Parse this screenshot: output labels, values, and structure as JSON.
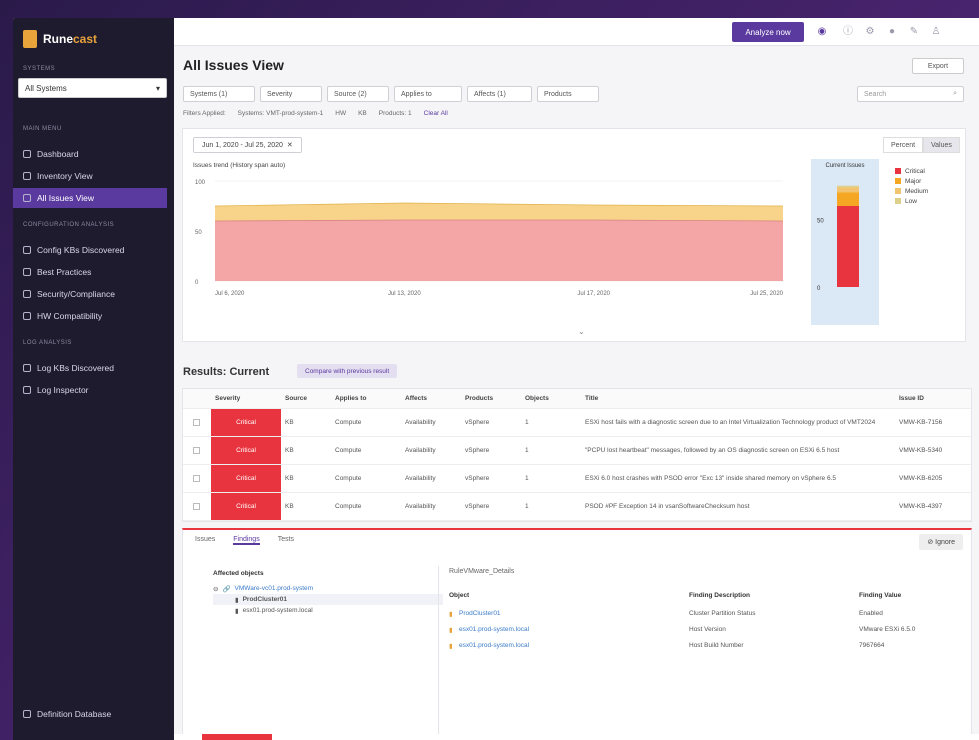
{
  "brand": {
    "name_a": "Rune",
    "name_b": "cast"
  },
  "sidebar": {
    "system_caption": "SYSTEMS",
    "system_select": "All Systems",
    "section1": "MAIN MENU",
    "items1": [
      {
        "label": "Dashboard",
        "icon": "dashboard-icon"
      },
      {
        "label": "Inventory View",
        "icon": "grid-icon"
      },
      {
        "label": "All Issues View",
        "icon": "issues-icon",
        "active": true
      }
    ],
    "section2": "CONFIGURATION ANALYSIS",
    "items2": [
      {
        "label": "Config KBs Discovered",
        "icon": "kb-icon"
      },
      {
        "label": "Best Practices",
        "icon": "check-icon"
      },
      {
        "label": "Security/Compliance",
        "icon": "shield-icon"
      },
      {
        "label": "HW Compatibility",
        "icon": "hardware-icon"
      }
    ],
    "section3": "LOG ANALYSIS",
    "items3": [
      {
        "label": "Log KBs Discovered",
        "icon": "log-icon"
      },
      {
        "label": "Log Inspector",
        "icon": "pulse-icon"
      }
    ],
    "bottom_item": "Definition Database"
  },
  "topbar": {
    "analyze_label": "Analyze now"
  },
  "page": {
    "title": "All Issues View",
    "export_label": "Export",
    "filters": [
      "Systems (1)",
      "Severity",
      "Source (2)",
      "Applies to",
      "Affects (1)",
      "Products"
    ],
    "search_placeholder": "Search",
    "applied": [
      "Filters Applied:",
      "Systems: VMT-prod-system-1",
      "HW",
      "KB",
      "Products: 1",
      "Clear All"
    ],
    "date_range": "Jun 1, 2020 - Jul 25, 2020",
    "toggle_a": "Percent",
    "toggle_b": "Values",
    "chart_label": "Issues trend (History span auto)",
    "bar_title": "Current Issues",
    "results_title": "Results: Current",
    "compare_label": "Compare with previous result"
  },
  "chart_data": [
    {
      "type": "area",
      "title": "Issues trend (History span auto)",
      "x": [
        "Jul 6, 2020",
        "Jul 13, 2020",
        "Jul 17, 2020",
        "Jul 25, 2020"
      ],
      "series": [
        {
          "name": "Critical",
          "values": [
            60,
            61,
            61,
            60
          ],
          "color": "#f4a6a6"
        },
        {
          "name": "Major",
          "values": [
            75,
            78,
            76,
            75
          ],
          "color": "#f7d48a"
        }
      ],
      "ylim": [
        0,
        100
      ],
      "yticks": [
        "100",
        "50",
        "0"
      ]
    },
    {
      "type": "bar",
      "title": "Current Issues",
      "categories": [
        "Current"
      ],
      "series": [
        {
          "name": "Critical",
          "values": [
            60
          ]
        },
        {
          "name": "Major",
          "values": [
            10
          ]
        },
        {
          "name": "Medium",
          "values": [
            4
          ]
        },
        {
          "name": "Low",
          "values": [
            1
          ]
        }
      ],
      "yticks": [
        "50",
        "0"
      ],
      "legend": [
        "Critical",
        "Major",
        "Medium",
        "Low"
      ],
      "colors": [
        "#e8343f",
        "#f5a623",
        "#f2c46f",
        "#dcd08a"
      ]
    }
  ],
  "table": {
    "headers": [
      "Severity",
      "Source",
      "Applies to",
      "Affects",
      "Products",
      "Objects",
      "Title",
      "Issue ID"
    ],
    "rows": [
      {
        "severity": "Critical",
        "source": "KB",
        "applies": "Compute",
        "affects": "Availability",
        "products": "vSphere",
        "objects": "1",
        "title": "ESXi host fails with a diagnostic screen due to an Intel Virtualization Technology product of VMT2024",
        "id": "VMW-KB-7156"
      },
      {
        "severity": "Critical",
        "source": "KB",
        "applies": "Compute",
        "affects": "Availability",
        "products": "vSphere",
        "objects": "1",
        "title": "\"PCPU lost heartbeat\" messages, followed by an OS diagnostic screen on ESXi 6.5 host",
        "id": "VMW-KB-5340"
      },
      {
        "severity": "Critical",
        "source": "KB",
        "applies": "Compute",
        "affects": "Availability",
        "products": "vSphere",
        "objects": "1",
        "title": "ESXi 6.0 host crashes with PSOD error \"Exc 13\" inside shared memory on vSphere 6.5",
        "id": "VMW-KB-6205"
      },
      {
        "severity": "Critical",
        "source": "KB",
        "applies": "Compute",
        "affects": "Availability",
        "products": "vSphere",
        "objects": "1",
        "title": "PSOD #PF Exception 14 in vsanSoftwareChecksum host",
        "id": "VMW-KB-4397"
      }
    ]
  },
  "detail": {
    "tabs": [
      "Issues",
      "Findings",
      "Tests"
    ],
    "ignore_label": "Ignore",
    "affected_title": "Affected objects",
    "tree": [
      "VMWare-vc01.prod-system",
      "ProdCluster01",
      "esx01.prod-system.local"
    ],
    "panel_title": "RuleVMware_Details",
    "finding_headers": [
      "Object",
      "Finding Description",
      "Finding Value"
    ],
    "findings": [
      {
        "object": "ProdCluster01",
        "desc": "Cluster Partition Status",
        "value": "Enabled"
      },
      {
        "object": "esx01.prod-system.local",
        "desc": "Host Version",
        "value": "VMware ESXi 6.5.0"
      },
      {
        "object": "esx01.prod-system.local",
        "desc": "Host Build Number",
        "value": "7967664"
      }
    ]
  }
}
